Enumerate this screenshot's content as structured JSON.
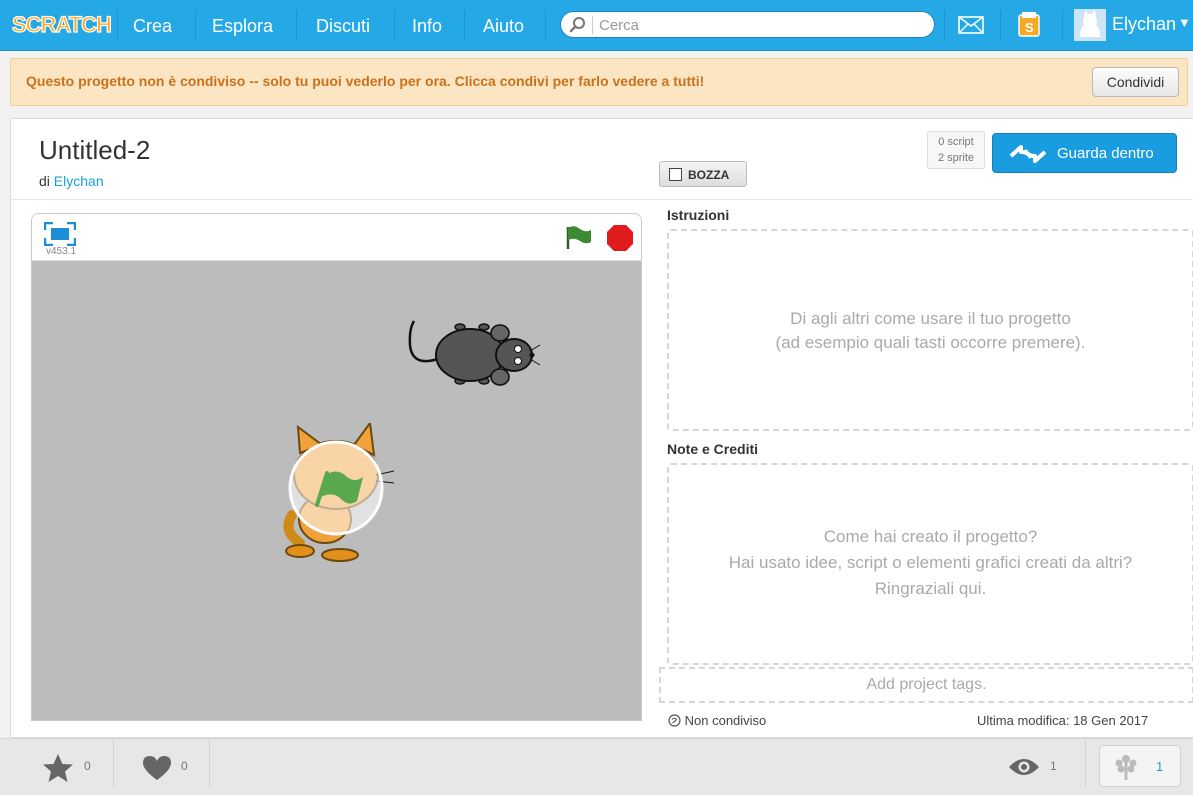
{
  "nav": {
    "logo": "SCRATCH",
    "items": [
      {
        "label": "Crea"
      },
      {
        "label": "Esplora"
      },
      {
        "label": "Discuti"
      },
      {
        "label": "Info"
      },
      {
        "label": "Aiuto"
      }
    ],
    "search_placeholder": "Cerca",
    "icons": [
      "search-icon",
      "messages-icon",
      "my-stuff-icon"
    ],
    "username": "Elychan"
  },
  "banner": {
    "message": "Questo progetto non è condiviso -- solo tu puoi vederlo per ora. Clicca condivi per farlo vedere a tutti!",
    "share_label": "Condividi"
  },
  "project": {
    "title": "Untitled-2",
    "by_prefix": "di",
    "author": "Elychan",
    "draft_label": "BOZZA",
    "scripts_count": "0 script",
    "sprites_count": "2 sprite",
    "see_inside_label": "Guarda dentro",
    "player_version": "v453.1"
  },
  "instructions": {
    "label": "Istruzioni",
    "placeholder_line1": "Di agli altri come usare il tuo progetto",
    "placeholder_line2": "(ad esempio quali tasti occorre premere)."
  },
  "notes": {
    "label": "Note e Crediti",
    "placeholder_line1": "Come hai creato il progetto?",
    "placeholder_line2": "Hai usato idee, script o elementi grafici creati da altri?",
    "placeholder_line3": "Ringraziali qui."
  },
  "tags_placeholder": "Add project tags.",
  "status": {
    "shared_state": "Non condiviso",
    "last_modified": "Ultima modifica: 18 Gen 2017"
  },
  "footer": {
    "favorites": "0",
    "loves": "0",
    "views": "1",
    "remixes": "1"
  },
  "colors": {
    "nav_bg": "#25a8e6",
    "banner_bg": "#fce5c2",
    "banner_text": "#c9721b",
    "accent_button": "#1a9ce0",
    "stage_bg": "#bcbcbc"
  }
}
